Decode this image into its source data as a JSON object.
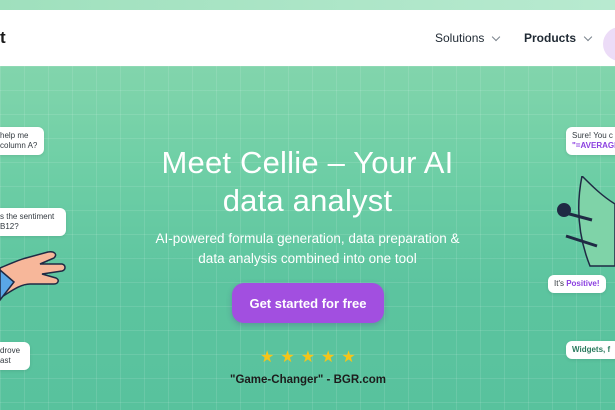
{
  "nav": {
    "logo_fragment": "t",
    "solutions_label": "Solutions",
    "products_label": "Products"
  },
  "hero": {
    "headline_line1": "Meet Cellie – Your AI",
    "headline_line2": "data analyst",
    "subtitle_line1": "AI-powered formula generation, data preparation &",
    "subtitle_line2": "data analysis combined into one tool",
    "cta_label": "Get started for free",
    "rating_stars": 5,
    "quote": "\"Game-Changer\" - BGR.com"
  },
  "bubbles": {
    "left1_line1": "help me",
    "left1_line2": "column A?",
    "left2_line1": "s the sentiment",
    "left2_line2": "B12?",
    "left3_line1": "drove",
    "left3_line2": "ast",
    "right1_line1": "Sure! You c",
    "right1_formula": "\"=AVERAGE",
    "right2_prefix": "It's ",
    "right2_value": "Positive!",
    "right3_text": "Widgets, f"
  },
  "colors": {
    "cta_bg": "#a24fe0",
    "star": "#f5c518",
    "accent_text": "#8b3fe0"
  }
}
